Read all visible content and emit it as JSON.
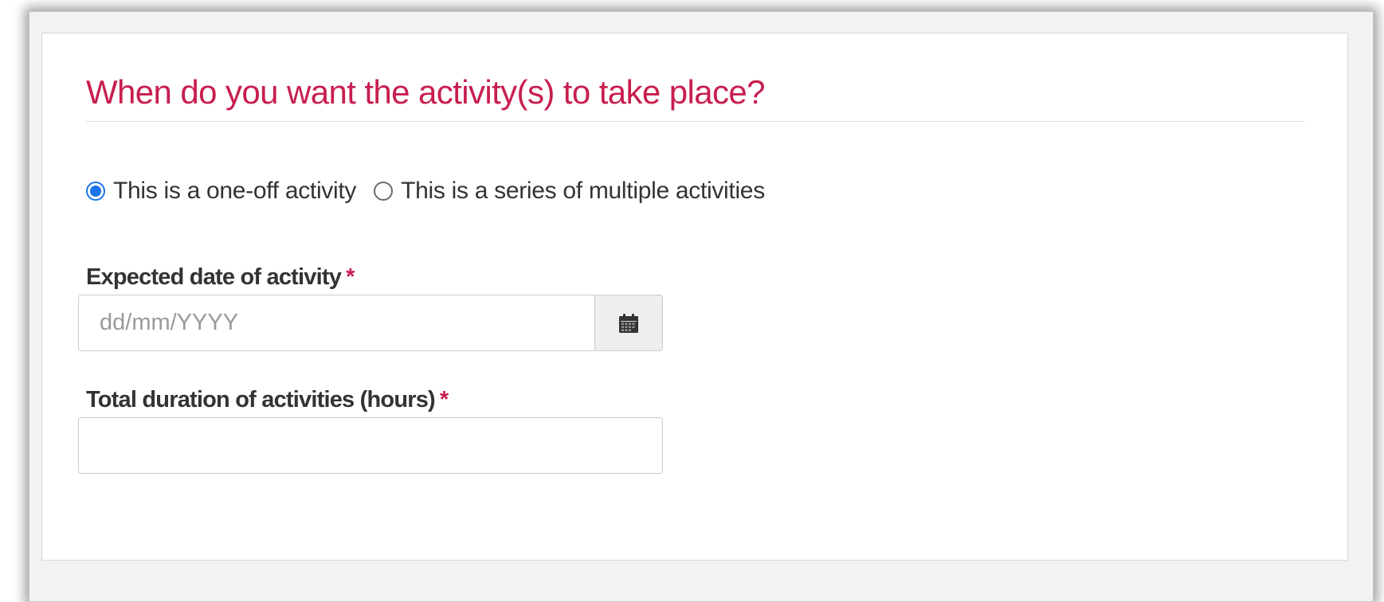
{
  "section": {
    "title": "When do you want the activity(s) to take place?"
  },
  "frequency": {
    "options": [
      {
        "label": "This is a one-off activity",
        "checked": true
      },
      {
        "label": "This is a series of multiple activities",
        "checked": false
      }
    ]
  },
  "date_field": {
    "label": "Expected date of activity",
    "required_marker": "*",
    "placeholder": "dd/mm/YYYY",
    "value": "",
    "icon": "calendar-icon"
  },
  "duration_field": {
    "label": "Total duration of activities (hours)",
    "required_marker": "*",
    "placeholder": "",
    "value": ""
  },
  "colors": {
    "title": "#c81e4f",
    "required": "#c81e4f",
    "radio_selected": "#1a73e8",
    "text": "#333333"
  }
}
